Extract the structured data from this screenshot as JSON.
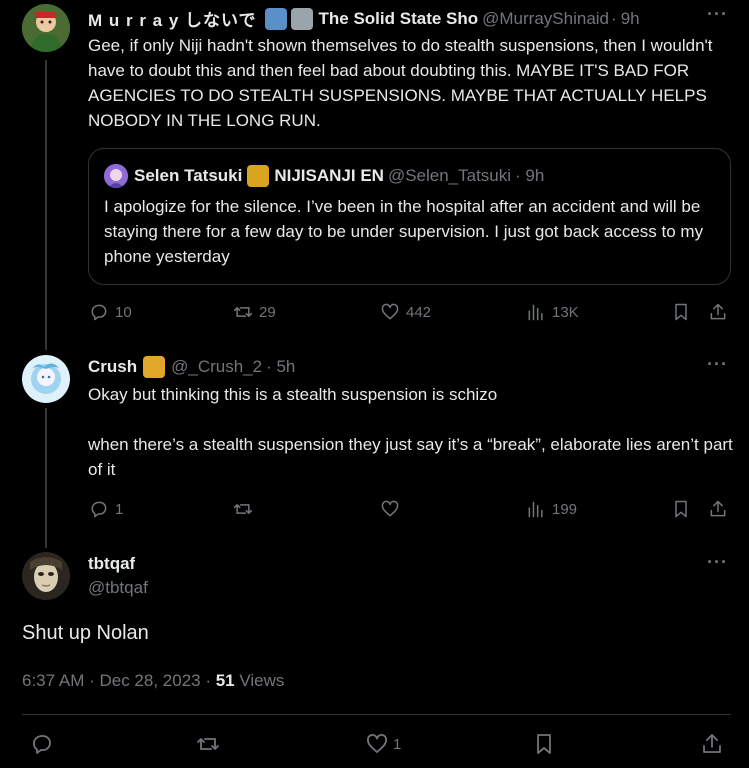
{
  "reply1": {
    "display_name": "M u r r a y しないで",
    "display_name_suffix": "The Solid State Sho",
    "handle": "@MurrayShinaid",
    "time": "9h",
    "more": "···",
    "text": "Gee, if only Niji hadn't shown themselves to do stealth suspensions, then I wouldn't have to doubt this and then feel bad about doubting this. MAYBE IT'S BAD FOR AGENCIES TO DO STEALTH SUSPENSIONS. MAYBE THAT ACTUALLY HELPS NOBODY IN THE LONG RUN.",
    "quote": {
      "display_name": "Selen Tatsuki",
      "display_name_suffix": "NIJISANJI EN",
      "handle": "@Selen_Tatsuki",
      "time": "· 9h",
      "text": "I apologize for the silence. I’ve been in the hospital after an accident and will be staying there for a few day to be under supervision. I just got back access to my phone yesterday"
    },
    "stats": {
      "replies": "10",
      "reposts": "29",
      "likes": "442",
      "views": "13K"
    }
  },
  "reply2": {
    "display_name": "Crush",
    "handle": "@_Crush_2",
    "time": "· 5h",
    "more": "···",
    "text_line1": "Okay but thinking this is a stealth suspension is schizo",
    "text_line2": "when there’s a stealth suspension they just say it’s a “break”, elaborate lies aren’t part of it",
    "stats": {
      "replies": "1",
      "reposts": "",
      "likes": "",
      "views": "199"
    }
  },
  "main_tweet": {
    "display_name": "tbtqaf",
    "handle": "@tbtqaf",
    "more": "···",
    "text": "Shut up Nolan",
    "timestamp": "6:37 AM · Dec 28, 2023 · ",
    "views_count": "51",
    "views_label": " Views",
    "stats": {
      "likes": "1"
    }
  },
  "dot_sep": "·",
  "colors": {
    "background": "#000000",
    "text": "#e7e9ea",
    "muted": "#71767b",
    "border": "#2f3336"
  }
}
